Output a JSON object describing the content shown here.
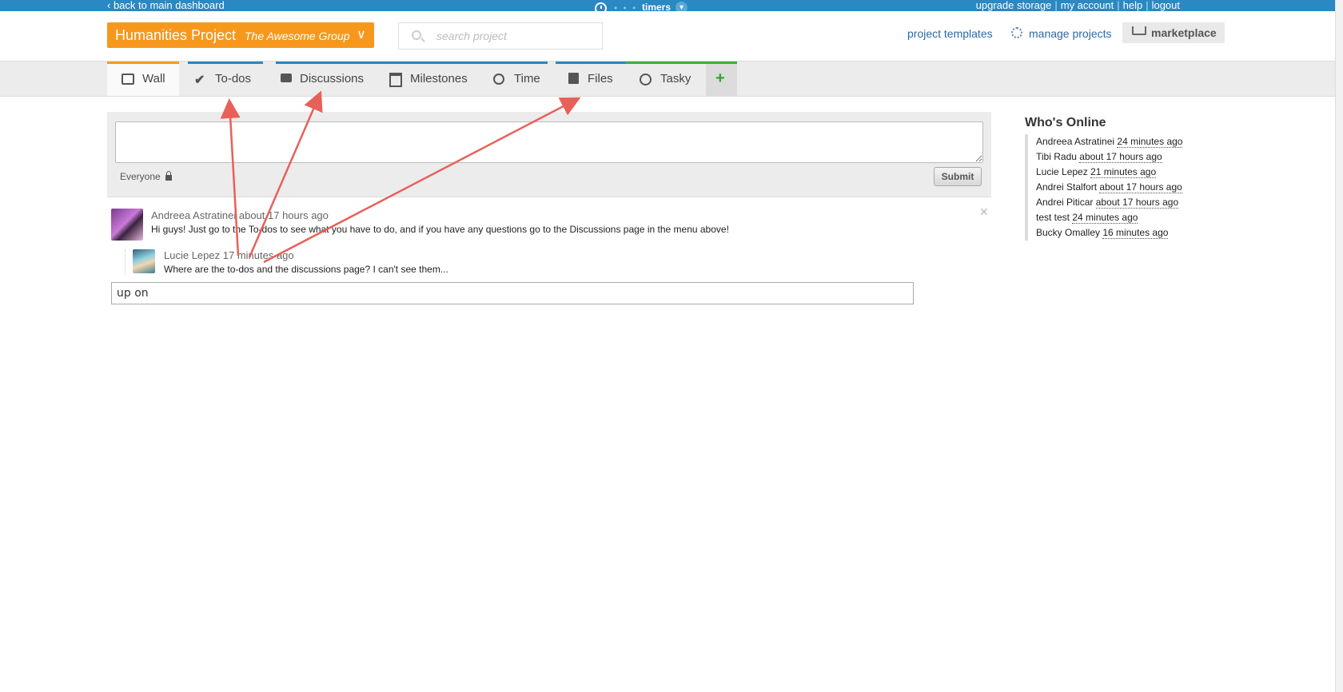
{
  "topbar": {
    "back_label": "‹ back to main dashboard",
    "timers_label": "timers",
    "links": [
      "upgrade storage",
      "my account",
      "help",
      "logout"
    ]
  },
  "header": {
    "project_name": "Humanities Project",
    "group_name": "The Awesome Group",
    "search_placeholder": "search project",
    "project_templates": "project templates",
    "manage_projects": "manage projects",
    "marketplace": "marketplace"
  },
  "nav": {
    "tabs": [
      {
        "label": "Wall",
        "icon": "speech-bubble-icon"
      },
      {
        "label": "To-dos",
        "icon": "checkmark-icon"
      },
      {
        "label": "Discussions",
        "icon": "chat-icon"
      },
      {
        "label": "Milestones",
        "icon": "calendar-icon"
      },
      {
        "label": "Time",
        "icon": "clock-icon"
      },
      {
        "label": "Files",
        "icon": "file-icon"
      },
      {
        "label": "Tasky",
        "icon": "check-circle-icon"
      }
    ],
    "add_label": "+"
  },
  "composer": {
    "audience": "Everyone",
    "submit_label": "Submit"
  },
  "posts": [
    {
      "author": "Andreea Astratinei",
      "time": "about 17 hours ago",
      "text": "Hi guys! Just go to the To-dos to see what you have to do, and if you have any questions go to the Discussions page in the menu above!",
      "replies": [
        {
          "author": "Lucie Lepez",
          "time": "17 minutes ago",
          "text": "Where are the to-dos and the discussions page? I can't see them..."
        }
      ]
    }
  ],
  "reply_input_value": "up on",
  "online": {
    "title": "Who's Online",
    "users": [
      {
        "name": "Andreea Astratinei",
        "time": "24 minutes ago"
      },
      {
        "name": "Tibi Radu",
        "time": "about 17 hours ago"
      },
      {
        "name": "Lucie Lepez",
        "time": "21 minutes ago"
      },
      {
        "name": "Andrei Stalfort",
        "time": "about 17 hours ago"
      },
      {
        "name": "Andrei Piticar",
        "time": "about 17 hours ago"
      },
      {
        "name": "test test",
        "time": "24 minutes ago"
      },
      {
        "name": "Bucky Omalley",
        "time": "16 minutes ago"
      }
    ]
  },
  "colors": {
    "topbar": "#2a88c2",
    "project_button": "#f7981d",
    "arrow": "#e8605a",
    "tasky_accent": "#3cae3c"
  }
}
